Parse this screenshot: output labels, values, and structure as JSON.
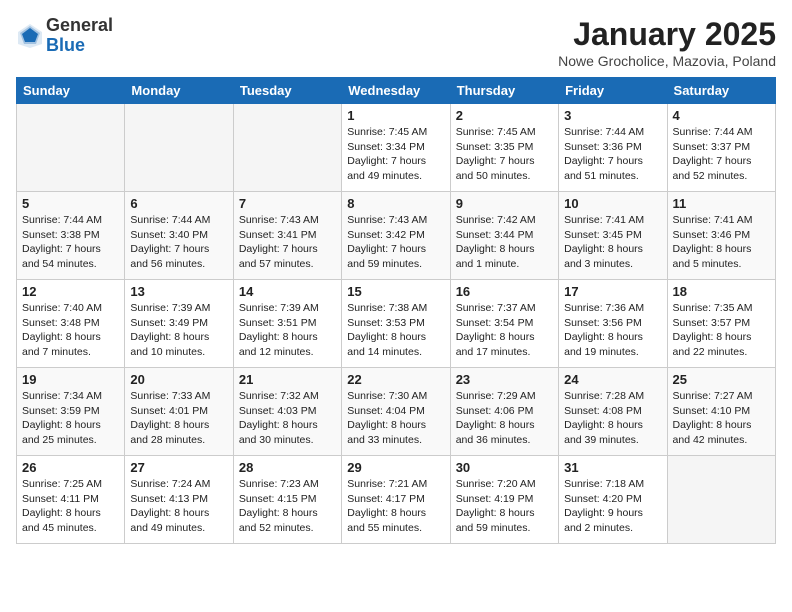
{
  "header": {
    "logo_general": "General",
    "logo_blue": "Blue",
    "title": "January 2025",
    "subtitle": "Nowe Grocholice, Mazovia, Poland"
  },
  "days_of_week": [
    "Sunday",
    "Monday",
    "Tuesday",
    "Wednesday",
    "Thursday",
    "Friday",
    "Saturday"
  ],
  "weeks": [
    [
      {
        "day": "",
        "info": ""
      },
      {
        "day": "",
        "info": ""
      },
      {
        "day": "",
        "info": ""
      },
      {
        "day": "1",
        "info": "Sunrise: 7:45 AM\nSunset: 3:34 PM\nDaylight: 7 hours\nand 49 minutes."
      },
      {
        "day": "2",
        "info": "Sunrise: 7:45 AM\nSunset: 3:35 PM\nDaylight: 7 hours\nand 50 minutes."
      },
      {
        "day": "3",
        "info": "Sunrise: 7:44 AM\nSunset: 3:36 PM\nDaylight: 7 hours\nand 51 minutes."
      },
      {
        "day": "4",
        "info": "Sunrise: 7:44 AM\nSunset: 3:37 PM\nDaylight: 7 hours\nand 52 minutes."
      }
    ],
    [
      {
        "day": "5",
        "info": "Sunrise: 7:44 AM\nSunset: 3:38 PM\nDaylight: 7 hours\nand 54 minutes."
      },
      {
        "day": "6",
        "info": "Sunrise: 7:44 AM\nSunset: 3:40 PM\nDaylight: 7 hours\nand 56 minutes."
      },
      {
        "day": "7",
        "info": "Sunrise: 7:43 AM\nSunset: 3:41 PM\nDaylight: 7 hours\nand 57 minutes."
      },
      {
        "day": "8",
        "info": "Sunrise: 7:43 AM\nSunset: 3:42 PM\nDaylight: 7 hours\nand 59 minutes."
      },
      {
        "day": "9",
        "info": "Sunrise: 7:42 AM\nSunset: 3:44 PM\nDaylight: 8 hours\nand 1 minute."
      },
      {
        "day": "10",
        "info": "Sunrise: 7:41 AM\nSunset: 3:45 PM\nDaylight: 8 hours\nand 3 minutes."
      },
      {
        "day": "11",
        "info": "Sunrise: 7:41 AM\nSunset: 3:46 PM\nDaylight: 8 hours\nand 5 minutes."
      }
    ],
    [
      {
        "day": "12",
        "info": "Sunrise: 7:40 AM\nSunset: 3:48 PM\nDaylight: 8 hours\nand 7 minutes."
      },
      {
        "day": "13",
        "info": "Sunrise: 7:39 AM\nSunset: 3:49 PM\nDaylight: 8 hours\nand 10 minutes."
      },
      {
        "day": "14",
        "info": "Sunrise: 7:39 AM\nSunset: 3:51 PM\nDaylight: 8 hours\nand 12 minutes."
      },
      {
        "day": "15",
        "info": "Sunrise: 7:38 AM\nSunset: 3:53 PM\nDaylight: 8 hours\nand 14 minutes."
      },
      {
        "day": "16",
        "info": "Sunrise: 7:37 AM\nSunset: 3:54 PM\nDaylight: 8 hours\nand 17 minutes."
      },
      {
        "day": "17",
        "info": "Sunrise: 7:36 AM\nSunset: 3:56 PM\nDaylight: 8 hours\nand 19 minutes."
      },
      {
        "day": "18",
        "info": "Sunrise: 7:35 AM\nSunset: 3:57 PM\nDaylight: 8 hours\nand 22 minutes."
      }
    ],
    [
      {
        "day": "19",
        "info": "Sunrise: 7:34 AM\nSunset: 3:59 PM\nDaylight: 8 hours\nand 25 minutes."
      },
      {
        "day": "20",
        "info": "Sunrise: 7:33 AM\nSunset: 4:01 PM\nDaylight: 8 hours\nand 28 minutes."
      },
      {
        "day": "21",
        "info": "Sunrise: 7:32 AM\nSunset: 4:03 PM\nDaylight: 8 hours\nand 30 minutes."
      },
      {
        "day": "22",
        "info": "Sunrise: 7:30 AM\nSunset: 4:04 PM\nDaylight: 8 hours\nand 33 minutes."
      },
      {
        "day": "23",
        "info": "Sunrise: 7:29 AM\nSunset: 4:06 PM\nDaylight: 8 hours\nand 36 minutes."
      },
      {
        "day": "24",
        "info": "Sunrise: 7:28 AM\nSunset: 4:08 PM\nDaylight: 8 hours\nand 39 minutes."
      },
      {
        "day": "25",
        "info": "Sunrise: 7:27 AM\nSunset: 4:10 PM\nDaylight: 8 hours\nand 42 minutes."
      }
    ],
    [
      {
        "day": "26",
        "info": "Sunrise: 7:25 AM\nSunset: 4:11 PM\nDaylight: 8 hours\nand 45 minutes."
      },
      {
        "day": "27",
        "info": "Sunrise: 7:24 AM\nSunset: 4:13 PM\nDaylight: 8 hours\nand 49 minutes."
      },
      {
        "day": "28",
        "info": "Sunrise: 7:23 AM\nSunset: 4:15 PM\nDaylight: 8 hours\nand 52 minutes."
      },
      {
        "day": "29",
        "info": "Sunrise: 7:21 AM\nSunset: 4:17 PM\nDaylight: 8 hours\nand 55 minutes."
      },
      {
        "day": "30",
        "info": "Sunrise: 7:20 AM\nSunset: 4:19 PM\nDaylight: 8 hours\nand 59 minutes."
      },
      {
        "day": "31",
        "info": "Sunrise: 7:18 AM\nSunset: 4:20 PM\nDaylight: 9 hours\nand 2 minutes."
      },
      {
        "day": "",
        "info": ""
      }
    ]
  ]
}
